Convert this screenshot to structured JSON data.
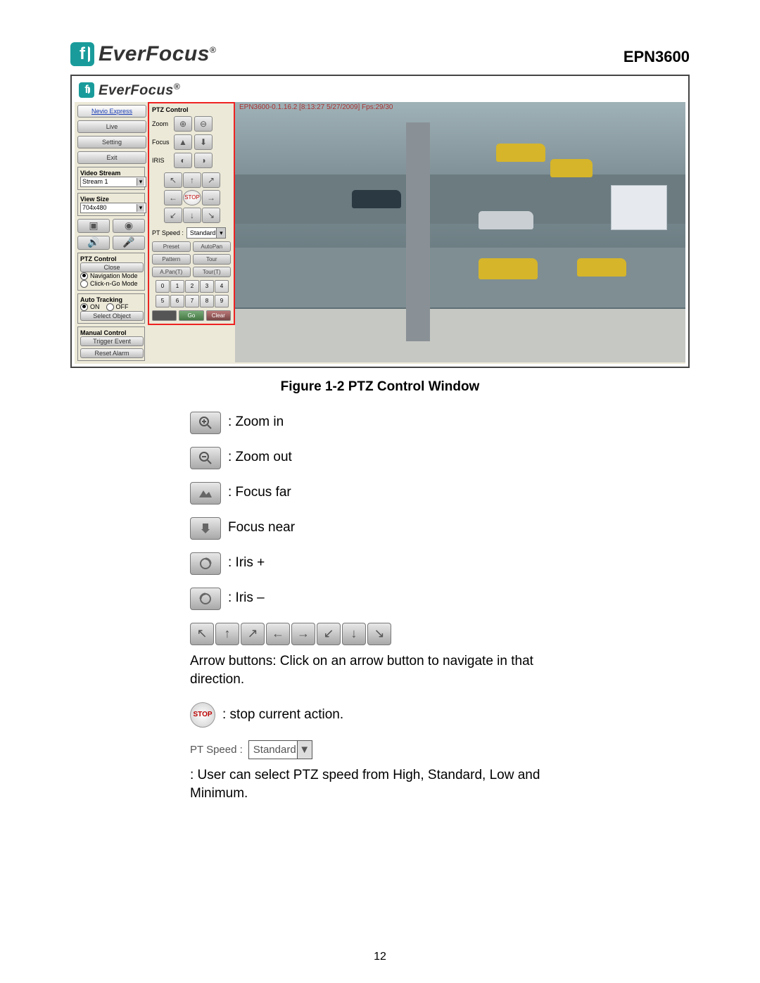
{
  "header": {
    "brand": "EverFocus",
    "registered": "®",
    "model": "EPN3600"
  },
  "app": {
    "brand": "EverFocus",
    "sidebar": {
      "nevio": "Nevio Express",
      "live": "Live",
      "setting": "Setting",
      "exit": "Exit",
      "video_stream_title": "Video Stream",
      "video_stream_value": "Stream 1",
      "view_size_title": "View Size",
      "view_size_value": "704x480",
      "ptz_control_title": "PTZ Control",
      "close": "Close",
      "nav_mode": "Navigation Mode",
      "click_go": "Click-n-Go Mode",
      "auto_tracking_title": "Auto Tracking",
      "on": "ON",
      "off": "OFF",
      "select_object": "Select Object",
      "manual_control_title": "Manual Control",
      "trigger_event": "Trigger Event",
      "reset_alarm": "Reset Alarm"
    },
    "ptz": {
      "title": "PTZ Control",
      "zoom": "Zoom",
      "focus": "Focus",
      "iris": "IRIS",
      "stop": "STOP",
      "pt_speed_label": "PT Speed :",
      "pt_speed_value": "Standard",
      "preset": "Preset",
      "autopan": "AutoPan",
      "pattern": "Pattern",
      "tour": "Tour",
      "apan_t": "A.Pan(T)",
      "tour_t": "Tour(T)",
      "nums": [
        "0",
        "1",
        "2",
        "3",
        "4",
        "5",
        "6",
        "7",
        "8",
        "9"
      ],
      "go": "Go",
      "clear": "Clear"
    },
    "video_overlay": "EPN3600-0.1.16.2 [8:13:27 5/27/2009] Fps:29/30"
  },
  "caption": "Figure 1-2 PTZ Control Window",
  "legend": {
    "zoom_in": ": Zoom in",
    "zoom_out": ": Zoom out",
    "focus_far": ": Focus far",
    "focus_near": "Focus near",
    "iris_plus": ": Iris +",
    "iris_minus": ": Iris –",
    "arrows_text": "Arrow buttons: Click on an arrow button to navigate in that direction.",
    "stop_text": ":    stop current action.",
    "pt_speed_label": "PT Speed :",
    "pt_speed_value": "Standard",
    "pt_speed_text": ": User can select PTZ speed from High, Standard, Low and Minimum."
  },
  "page_number": "12"
}
